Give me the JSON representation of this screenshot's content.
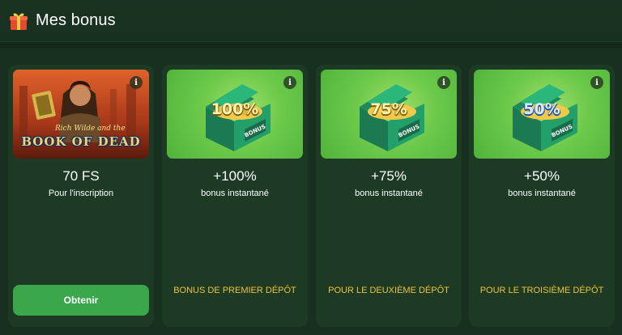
{
  "header": {
    "title": "Mes bonus",
    "icon": "gift-icon"
  },
  "cards": [
    {
      "amount": "70 FS",
      "desc": "Pour l'inscription",
      "image": {
        "title": "BOOK OF DEAD",
        "subtitle": "Rich Wilde and the"
      },
      "button": "Obtenir",
      "info": "i"
    },
    {
      "amount": "+100%",
      "desc": "bonus instantané",
      "chest_label": "100%",
      "chest_tag": "BONUS",
      "note": "BONUS DE PREMIER DÉPÔT",
      "info": "i"
    },
    {
      "amount": "+75%",
      "desc": "bonus instantané",
      "chest_label": "75%",
      "chest_tag": "BONUS",
      "note": "POUR LE DEUXIÈME DÉPÔT",
      "info": "i"
    },
    {
      "amount": "+50%",
      "desc": "bonus instantané",
      "chest_label": "50%",
      "chest_tag": "BONUS",
      "note": "POUR LE TROISIÈME DÉPÔT",
      "info": "i"
    }
  ],
  "colors": {
    "background": "#14291a",
    "card": "#1d3a25",
    "button": "#3aa74a",
    "note": "#f1c232"
  }
}
